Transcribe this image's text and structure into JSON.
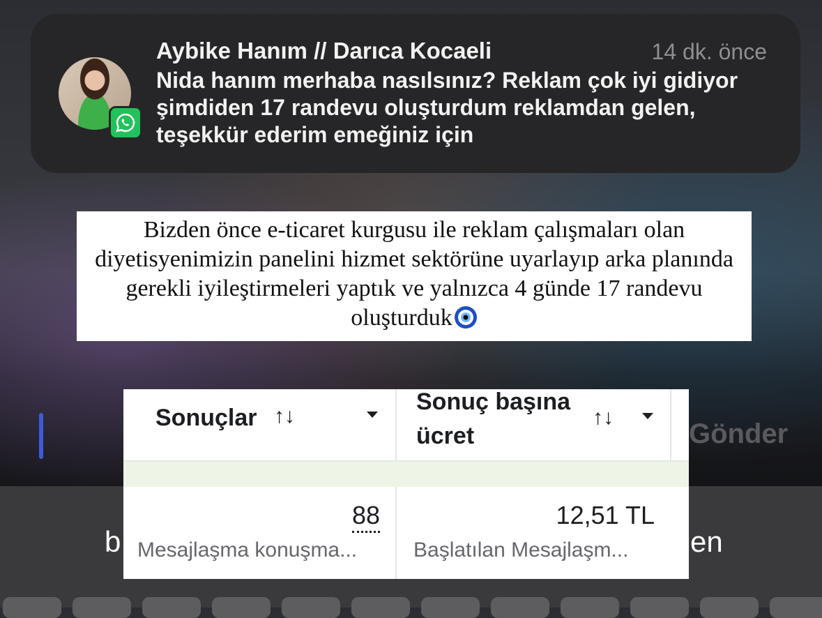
{
  "notification": {
    "sender": "Aybike Hanım // Darıca Kocaeli",
    "time": "14 dk. önce",
    "message": "Nida hanım merhaba nasılsınız? Reklam çok iyi gidiyor şimdiden 17 randevu oluşturdum reklamdan gelen, teşekkür ederim emeğiniz için",
    "app_icon": "whatsapp-icon"
  },
  "caption": {
    "text": "Bizden önce e-ticaret kurgusu ile reklam çalışmaları olan diyetisyenimizin panelini hizmet sektörüne uyarlayıp arka planında gerekli iyileştirmeleri yaptık ve yalnızca 4 günde 17 randevu oluşturduk",
    "emoji": "nazar-boncugu-icon"
  },
  "input_bar": {
    "send_label": "Gönder"
  },
  "keyboard": {
    "left_fragment": "b",
    "right_fragment": "en"
  },
  "results_table": {
    "columns": [
      {
        "label": "Sonuçlar",
        "sort_icon": "↑↓"
      },
      {
        "label_line1": "Sonuç başına",
        "label_line2": "ücret",
        "sort_icon": "↑↓"
      }
    ],
    "row": {
      "results_value": "88",
      "results_desc": "Mesajlaşma konuşma...",
      "cost_value": "12,51 TL",
      "cost_desc": "Başlatılan Mesajlaşm..."
    }
  },
  "colors": {
    "whatsapp": "#23c15b",
    "cursor": "#3d5bd6",
    "band": "#eef5e7"
  }
}
